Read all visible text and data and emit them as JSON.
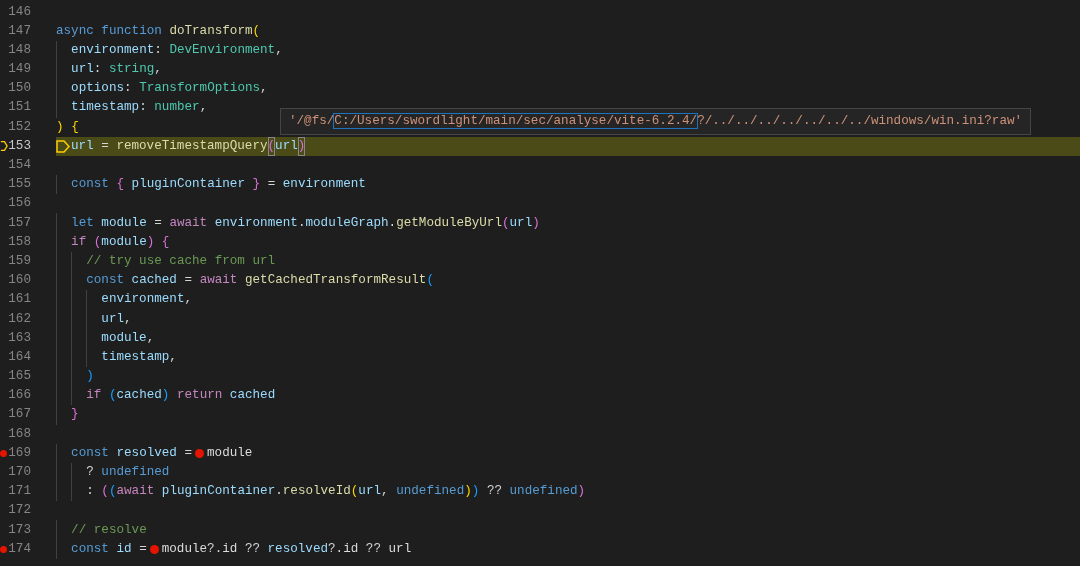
{
  "editor": {
    "lines": [
      {
        "number": "146",
        "breakpoint": false,
        "current": false
      },
      {
        "number": "147",
        "breakpoint": false,
        "current": false,
        "tokens": [
          {
            "text": "async ",
            "kind": "keyword"
          },
          {
            "text": "function ",
            "kind": "keyword"
          },
          {
            "text": "doTransform",
            "kind": "function"
          },
          {
            "text": "(",
            "kind": "bracket1"
          }
        ]
      },
      {
        "number": "148",
        "breakpoint": false,
        "current": false,
        "tokens": [
          {
            "text": "  environment",
            "kind": "variable"
          },
          {
            "text": ": ",
            "kind": "plain"
          },
          {
            "text": "DevEnvironment",
            "kind": "type"
          },
          {
            "text": ",",
            "kind": "plain"
          }
        ]
      },
      {
        "number": "149",
        "breakpoint": false,
        "current": false,
        "tokens": [
          {
            "text": "  url",
            "kind": "variable"
          },
          {
            "text": ": ",
            "kind": "plain"
          },
          {
            "text": "string",
            "kind": "type"
          },
          {
            "text": ",",
            "kind": "plain"
          }
        ]
      },
      {
        "number": "150",
        "breakpoint": false,
        "current": false,
        "tokens": [
          {
            "text": "  options",
            "kind": "variable"
          },
          {
            "text": ": ",
            "kind": "plain"
          },
          {
            "text": "TransformOptions",
            "kind": "type"
          },
          {
            "text": ",",
            "kind": "plain"
          }
        ]
      },
      {
        "number": "151",
        "breakpoint": false,
        "current": false,
        "tokens": [
          {
            "text": "  timestamp",
            "kind": "variable"
          },
          {
            "text": ": ",
            "kind": "plain"
          },
          {
            "text": "number",
            "kind": "type"
          },
          {
            "text": ",",
            "kind": "plain"
          }
        ]
      },
      {
        "number": "152",
        "breakpoint": false,
        "current": false,
        "tokens": [
          {
            "text": ") ",
            "kind": "bracket1"
          },
          {
            "text": "{",
            "kind": "bracket1"
          }
        ]
      },
      {
        "number": "153",
        "breakpoint": false,
        "current": true,
        "tokens": [
          {
            "kind": "exec-marker"
          },
          {
            "text": "url",
            "kind": "variable"
          },
          {
            "text": " = ",
            "kind": "plain"
          },
          {
            "text": "removeTimestampQuery",
            "kind": "function"
          },
          {
            "text": "(",
            "kind": "bracket2",
            "matched": true
          },
          {
            "text": "url",
            "kind": "variable"
          },
          {
            "text": ")",
            "kind": "bracket2",
            "matched": true
          }
        ]
      },
      {
        "number": "154",
        "breakpoint": false,
        "current": false
      },
      {
        "number": "155",
        "breakpoint": false,
        "current": false,
        "tokens": [
          {
            "text": "  const ",
            "kind": "keyword"
          },
          {
            "text": "{ ",
            "kind": "bracket2"
          },
          {
            "text": "pluginContainer ",
            "kind": "variable"
          },
          {
            "text": "}",
            "kind": "bracket2"
          },
          {
            "text": " = ",
            "kind": "plain"
          },
          {
            "text": "environment",
            "kind": "variable"
          }
        ]
      },
      {
        "number": "156",
        "breakpoint": false,
        "current": false
      },
      {
        "number": "157",
        "breakpoint": false,
        "current": false,
        "tokens": [
          {
            "text": "  let ",
            "kind": "keyword"
          },
          {
            "text": "module",
            "kind": "variable"
          },
          {
            "text": " = ",
            "kind": "plain"
          },
          {
            "text": "await ",
            "kind": "control"
          },
          {
            "text": "environment",
            "kind": "variable"
          },
          {
            "text": ".",
            "kind": "plain"
          },
          {
            "text": "moduleGraph",
            "kind": "variable"
          },
          {
            "text": ".",
            "kind": "plain"
          },
          {
            "text": "getModuleByUrl",
            "kind": "function"
          },
          {
            "text": "(",
            "kind": "bracket2"
          },
          {
            "text": "url",
            "kind": "variable"
          },
          {
            "text": ")",
            "kind": "bracket2"
          }
        ]
      },
      {
        "number": "158",
        "breakpoint": false,
        "current": false,
        "tokens": [
          {
            "text": "  if ",
            "kind": "control"
          },
          {
            "text": "(",
            "kind": "bracket2"
          },
          {
            "text": "module",
            "kind": "variable"
          },
          {
            "text": ") ",
            "kind": "bracket2"
          },
          {
            "text": "{",
            "kind": "bracket2"
          }
        ]
      },
      {
        "number": "159",
        "breakpoint": false,
        "current": false,
        "tokens": [
          {
            "text": "    // try use cache from url",
            "kind": "comment"
          }
        ]
      },
      {
        "number": "160",
        "breakpoint": false,
        "current": false,
        "tokens": [
          {
            "text": "    const ",
            "kind": "keyword"
          },
          {
            "text": "cached",
            "kind": "variable"
          },
          {
            "text": " = ",
            "kind": "plain"
          },
          {
            "text": "await ",
            "kind": "control"
          },
          {
            "text": "getCachedTransformResult",
            "kind": "function"
          },
          {
            "text": "(",
            "kind": "bracket3"
          }
        ]
      },
      {
        "number": "161",
        "breakpoint": false,
        "current": false,
        "tokens": [
          {
            "text": "      environment",
            "kind": "variable"
          },
          {
            "text": ",",
            "kind": "plain"
          }
        ]
      },
      {
        "number": "162",
        "breakpoint": false,
        "current": false,
        "tokens": [
          {
            "text": "      url",
            "kind": "variable"
          },
          {
            "text": ",",
            "kind": "plain"
          }
        ]
      },
      {
        "number": "163",
        "breakpoint": false,
        "current": false,
        "tokens": [
          {
            "text": "      module",
            "kind": "variable"
          },
          {
            "text": ",",
            "kind": "plain"
          }
        ]
      },
      {
        "number": "164",
        "breakpoint": false,
        "current": false,
        "tokens": [
          {
            "text": "      timestamp",
            "kind": "variable"
          },
          {
            "text": ",",
            "kind": "plain"
          }
        ]
      },
      {
        "number": "165",
        "breakpoint": false,
        "current": false,
        "tokens": [
          {
            "text": "    )",
            "kind": "bracket3"
          }
        ]
      },
      {
        "number": "166",
        "breakpoint": false,
        "current": false,
        "tokens": [
          {
            "text": "    if ",
            "kind": "control"
          },
          {
            "text": "(",
            "kind": "bracket3"
          },
          {
            "text": "cached",
            "kind": "variable"
          },
          {
            "text": ") ",
            "kind": "bracket3"
          },
          {
            "text": "return ",
            "kind": "control"
          },
          {
            "text": "cached",
            "kind": "variable"
          }
        ]
      },
      {
        "number": "167",
        "breakpoint": false,
        "current": false,
        "tokens": [
          {
            "text": "  }",
            "kind": "bracket2"
          }
        ]
      },
      {
        "number": "168",
        "breakpoint": false,
        "current": false
      },
      {
        "number": "169",
        "breakpoint": true,
        "current": false,
        "tokens": [
          {
            "text": "  const ",
            "kind": "keyword"
          },
          {
            "text": "resolved",
            "kind": "variable"
          },
          {
            "text": " =",
            "kind": "plain"
          },
          {
            "kind": "inline-breakpoint"
          },
          {
            "text": "module",
            "kind": "local"
          }
        ]
      },
      {
        "number": "170",
        "breakpoint": false,
        "current": false,
        "tokens": [
          {
            "text": "    ? ",
            "kind": "plain"
          },
          {
            "text": "undefined",
            "kind": "keyword"
          }
        ]
      },
      {
        "number": "171",
        "breakpoint": false,
        "current": false,
        "tokens": [
          {
            "text": "    : ",
            "kind": "plain"
          },
          {
            "text": "(",
            "kind": "bracket2"
          },
          {
            "text": "(",
            "kind": "bracket3"
          },
          {
            "text": "await ",
            "kind": "control"
          },
          {
            "text": "pluginContainer",
            "kind": "variable"
          },
          {
            "text": ".",
            "kind": "plain"
          },
          {
            "text": "resolveId",
            "kind": "function"
          },
          {
            "text": "(",
            "kind": "bracket1"
          },
          {
            "text": "url",
            "kind": "variable"
          },
          {
            "text": ", ",
            "kind": "plain"
          },
          {
            "text": "undefined",
            "kind": "keyword"
          },
          {
            "text": ")",
            "kind": "bracket1"
          },
          {
            "text": ")",
            "kind": "bracket3"
          },
          {
            "text": " ?? ",
            "kind": "plain"
          },
          {
            "text": "undefined",
            "kind": "keyword"
          },
          {
            "text": ")",
            "kind": "bracket2"
          }
        ]
      },
      {
        "number": "172",
        "breakpoint": false,
        "current": false
      },
      {
        "number": "173",
        "breakpoint": false,
        "current": false,
        "tokens": [
          {
            "text": "  // resolve",
            "kind": "comment"
          }
        ]
      },
      {
        "number": "174",
        "breakpoint": true,
        "current": false,
        "tokens": [
          {
            "text": "  const ",
            "kind": "keyword"
          },
          {
            "text": "id",
            "kind": "variable"
          },
          {
            "text": " =",
            "kind": "plain"
          },
          {
            "kind": "inline-breakpoint"
          },
          {
            "text": "module",
            "kind": "local"
          },
          {
            "text": "?.",
            "kind": "plain"
          },
          {
            "text": "id",
            "kind": "local"
          },
          {
            "text": " ?? ",
            "kind": "plain"
          },
          {
            "text": "resolved",
            "kind": "variable"
          },
          {
            "text": "?.",
            "kind": "plain"
          },
          {
            "text": "id",
            "kind": "local"
          },
          {
            "text": " ?? ",
            "kind": "plain"
          },
          {
            "text": "url",
            "kind": "local"
          }
        ]
      }
    ]
  },
  "hover": {
    "parts": [
      {
        "text": "'/@fs/",
        "highlighted": false
      },
      {
        "text": "C:/Users/swordlight/main/sec/analyse/vite-6.2.4/",
        "highlighted": true
      },
      {
        "text": "?/../../../../../../../windows/win.ini?raw'",
        "highlighted": false
      }
    ]
  }
}
